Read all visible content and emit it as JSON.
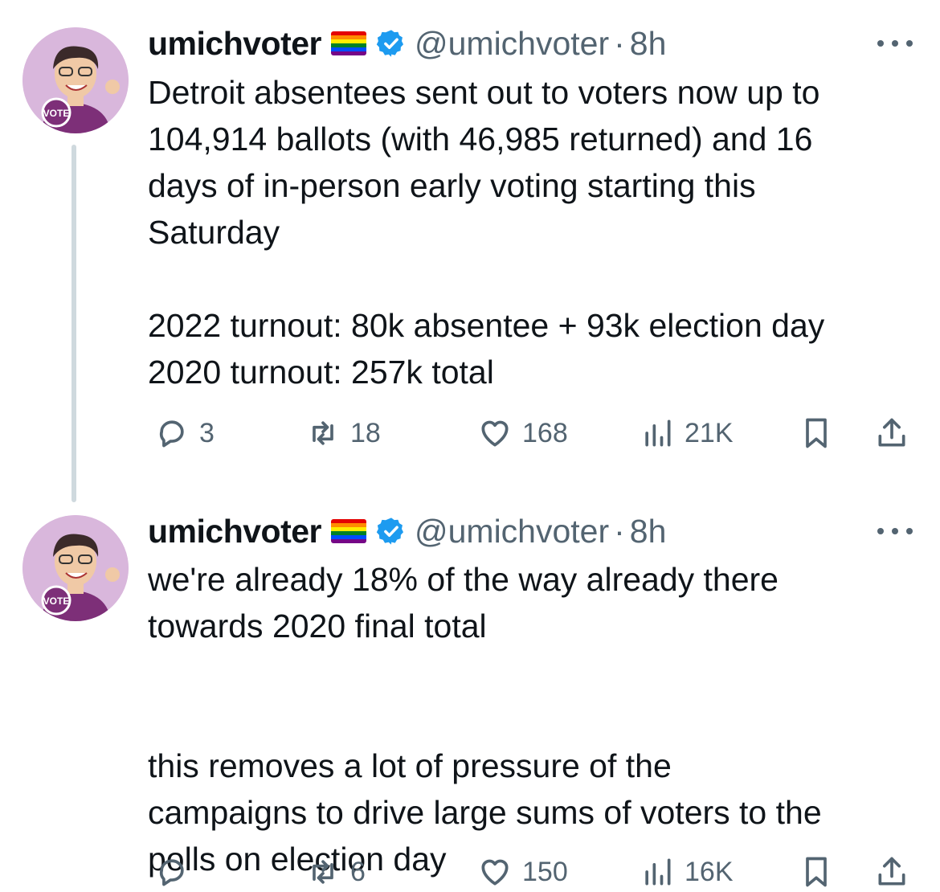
{
  "tweets": [
    {
      "name": "umichvoter",
      "handle": "@umichvoter",
      "sep": "·",
      "time": "8h",
      "text": "Detroit absentees sent out to voters now up to\n104,914 ballots (with 46,985 returned) and 16\ndays of in-person early voting starting this\nSaturday\n\n2022 turnout: 80k absentee + 93k election day\n2020 turnout: 257k total",
      "replies": "3",
      "reposts": "18",
      "likes": "168",
      "views": "21K"
    },
    {
      "name": "umichvoter",
      "handle": "@umichvoter",
      "sep": "·",
      "time": "8h",
      "text": "we're already 18% of the way already there\ntowards 2020 final total\n\n\nthis removes a lot of pressure of the\ncampaigns to drive large sums of voters to the\npolls on election day",
      "replies": "",
      "reposts": "6",
      "likes": "150",
      "views": "16K"
    }
  ],
  "avatar_badge": "VOTE",
  "colors": {
    "text": "#0f1419",
    "secondary": "#536471",
    "verified": "#1d9bf0",
    "avatar_bg": "#d9b7dc",
    "thread_line": "#cfd9de"
  },
  "icons": [
    "reply-icon",
    "repost-icon",
    "like-icon",
    "views-icon",
    "bookmark-icon",
    "share-icon",
    "more-icon",
    "verified-icon",
    "pride-flag-icon"
  ]
}
